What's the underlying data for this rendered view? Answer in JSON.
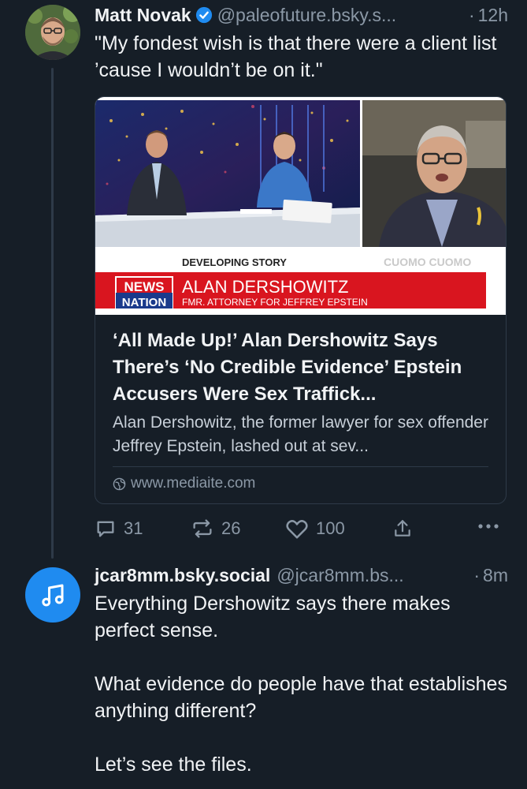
{
  "post1": {
    "name": "Matt Novak",
    "handle": "@paleofuture.bsky.s...",
    "separator": "·",
    "time": "12h",
    "text": "\"My fondest wish is that there were a client list ’cause I wouldn’t be on it.\""
  },
  "card": {
    "image": {
      "banner_top": "DEVELOPING STORY",
      "banner_name": "ALAN DERSHOWITZ",
      "banner_sub": "FMR. ATTORNEY FOR JEFFREY EPSTEIN",
      "logo_top": "NEWS",
      "logo_bottom": "NATION",
      "ticker": "CUOMO CUOMO"
    },
    "title": "‘All Made Up!’ Alan Dershowitz Says There’s ‘No Credible Evidence’ Epstein Accusers Were Sex Traffick...",
    "description": "Alan Dershowitz, the former lawyer for sex offender Jeffrey Epstein, lashed out at sev...",
    "domain": "www.mediaite.com"
  },
  "actions": {
    "replies": "31",
    "reposts": "26",
    "likes": "100"
  },
  "post2": {
    "name": "jcar8mm.bsky.social",
    "handle": "@jcar8mm.bs...",
    "separator": "·",
    "time": "8m",
    "paragraph1": "Everything Dershowitz says there makes perfect sense.",
    "paragraph2": "What evidence do people have that establishes anything different?",
    "paragraph3": "Let’s see the files."
  },
  "colors": {
    "background": "#161e27",
    "verified": "#1f8bf0",
    "muted": "#8b98a6",
    "news_red": "#d9151f"
  }
}
